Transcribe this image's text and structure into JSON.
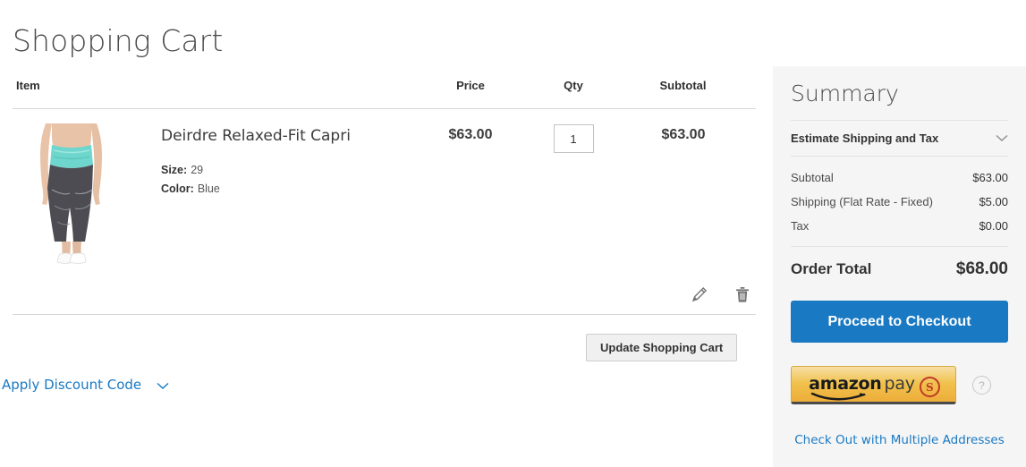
{
  "page": {
    "title": "Shopping Cart"
  },
  "cart": {
    "headers": {
      "item": "Item",
      "price": "Price",
      "qty": "Qty",
      "subtotal": "Subtotal"
    },
    "items": [
      {
        "name": "Deirdre Relaxed-Fit Capri",
        "options": [
          {
            "label": "Size:",
            "value": "29"
          },
          {
            "label": "Color:",
            "value": "Blue"
          }
        ],
        "price": "$63.00",
        "qty": "1",
        "subtotal": "$63.00",
        "image_alt": "Deirdre Relaxed-Fit Capri product photo",
        "edit_icon": "pencil-icon",
        "delete_icon": "trash-icon"
      }
    ],
    "update_button": "Update Shopping Cart",
    "discount_toggle": "Apply Discount Code",
    "discount_chevron_icon": "chevron-down-icon"
  },
  "summary": {
    "title": "Summary",
    "estimate": {
      "label": "Estimate Shipping and Tax",
      "chevron_icon": "chevron-down-icon"
    },
    "totals": [
      {
        "label": "Subtotal",
        "value": "$63.00"
      },
      {
        "label": "Shipping (Flat Rate - Fixed)",
        "value": "$5.00"
      },
      {
        "label": "Tax",
        "value": "$0.00"
      }
    ],
    "grand_total": {
      "label": "Order Total",
      "value": "$68.00"
    },
    "checkout_button": "Proceed to Checkout",
    "amazon_pay": {
      "brand": "amazon",
      "suffix": "pay",
      "badge": "S",
      "help_icon": "question-mark-icon",
      "help_label": "?"
    },
    "multiple_addresses_link": "Check Out with Multiple Addresses"
  },
  "colors": {
    "accent_blue": "#1979c3",
    "summary_bg": "#f5f5f5",
    "amazon_yellow": "#f0c14b",
    "badge_red": "#c0392b",
    "text_dark": "#333333"
  }
}
